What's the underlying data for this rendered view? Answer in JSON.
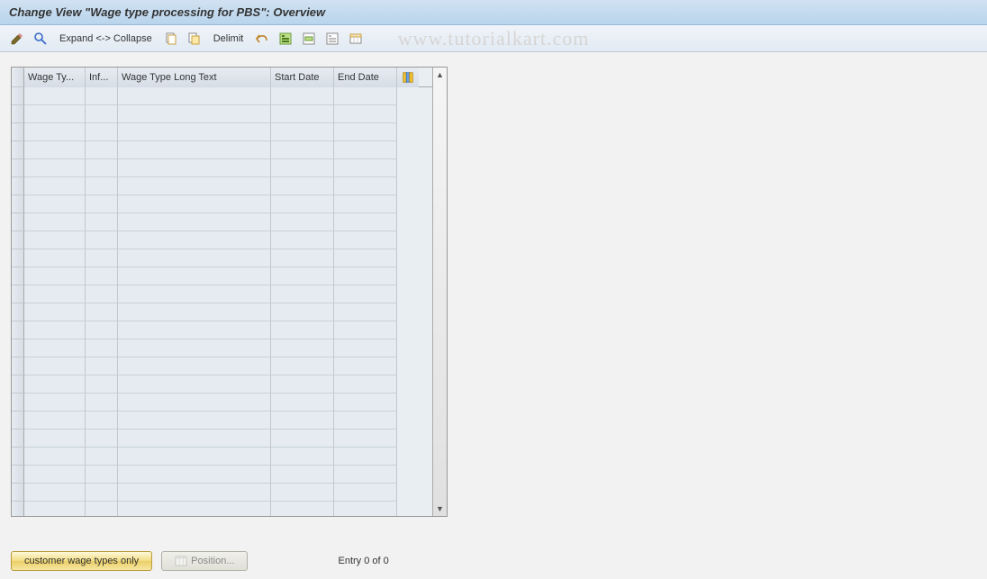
{
  "title": "Change View \"Wage type processing for PBS\": Overview",
  "toolbar": {
    "expand_collapse": "Expand <-> Collapse",
    "delimit": "Delimit"
  },
  "table": {
    "columns": {
      "wage_type": "Wage Ty...",
      "inf": "Inf...",
      "long_text": "Wage Type Long Text",
      "start_date": "Start Date",
      "end_date": "End Date"
    },
    "row_count": 24
  },
  "footer": {
    "customer_btn": "customer wage types only",
    "position_btn": "Position...",
    "entry_label": "Entry 0 of 0"
  },
  "watermark": "www.tutorialkart.com"
}
